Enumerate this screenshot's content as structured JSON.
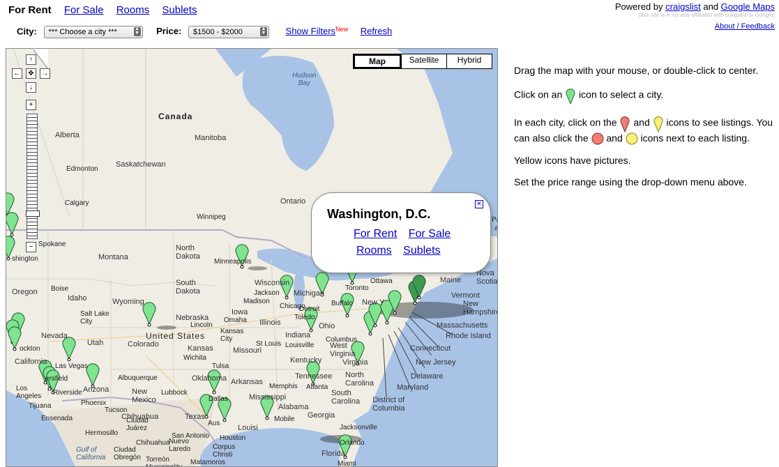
{
  "nav": {
    "current": "For Rent",
    "links": [
      "For Sale",
      "Rooms",
      "Sublets"
    ]
  },
  "powered": {
    "prefix": "Powered by",
    "craigslist": "craigslist",
    "and": "and",
    "gmaps": "Google Maps",
    "disclaimer": "(this site is in no way affiliated with craigslist or Google)",
    "about": "About / Feedback"
  },
  "filters": {
    "city_label": "City:",
    "city_value": "*** Choose a city ***",
    "price_label": "Price:",
    "price_value": "$1500 - $2000",
    "show_filters": "Show Filters",
    "new_badge": "New",
    "refresh": "Refresh"
  },
  "map": {
    "types": [
      "Map",
      "Satellite",
      "Hybrid"
    ],
    "active_type": "Map",
    "colors": {
      "water": "#a9c3e6",
      "land": "#f0ede5",
      "canada": "#ece9df",
      "marker": "#7fe38f",
      "marker_dark": "#3e9a52"
    },
    "labels": {
      "hudson": "Hudson\nBay",
      "canada": "Canada",
      "alberta": "Alberta",
      "manitoba": "Manitoba",
      "saskatchewan": "Saskatchewan",
      "edmonton": "Edmonton",
      "calgary": "Calgary",
      "ontario": "Ontario",
      "winnipeg": "Winnipeg",
      "spokane": "Spokane",
      "shington": "shington",
      "oregon": "Oregon",
      "boise": "Boise",
      "idaho": "Idaho",
      "montana": "Montana",
      "north_dakota": "North\nDakota",
      "south_dakota": "South\nDakota",
      "wyoming": "Wyoming",
      "minneapolis": "Minneapolis",
      "wisconsin": "Wisconsin",
      "jackson": "Jackson",
      "madison": "Madison",
      "michigan": "Michigan",
      "chicago": "Chicago",
      "detroit": "Detroit",
      "toronto": "Toronto",
      "ottawa": "Ottawa",
      "maine": "Maine",
      "nova_scotia": "Nova\nScotia",
      "vermont": "Vermont",
      "new_hampshire": "New\nHampshire",
      "massachusetts": "Massachusetts",
      "rhode_island": "Rhode Island",
      "connecticut": "Connecticut",
      "new_jersey": "New Jersey",
      "delaware": "Delaware",
      "maryland": "Maryland",
      "dc": "District of\nColumbia",
      "buffalo": "Buffalo",
      "toledo": "Toledo",
      "new_york": "New Y",
      "nevada": "Nevada",
      "utah": "Utah",
      "salt_lake": "Salt Lake\nCity",
      "colorado": "Colorado",
      "united_states": "United States",
      "nebraska": "Nebraska",
      "lincoln": "Lincoln",
      "omaha": "Omaha",
      "iowa": "Iowa",
      "illinois": "Illinois",
      "indiana": "Indiana",
      "ohio": "Ohio",
      "columbus": "Columbus",
      "louisville": "Louisville",
      "west_virginia": "West\nVirginia",
      "virginia": "Virginia",
      "kansas": "Kansas",
      "kansas_city": "Kansas\nCity",
      "wichita": "Wichita",
      "st_louis": "St Louis",
      "missouri": "Missouri",
      "kentucky": "Kentucky",
      "tennessee": "Tennessee",
      "north_carolina": "North\nCarolina",
      "south_carolina": "South\nCarolina",
      "atlanta": "Atlanta",
      "georgia": "Georgia",
      "alabama": "Alabama",
      "mississippi": "Mississippi",
      "memphis": "Memphis",
      "arkansas": "Arkansas",
      "oklahoma": "Oklahoma",
      "tulsa": "Tulsa",
      "dallas": "Dallas",
      "texas": "Texas",
      "austin": "Aus",
      "houston": "Houston",
      "san_antonio": "San Antonio",
      "louisiana": "Louisi",
      "mobile": "Mobile",
      "jacksonville": "Jacksonville",
      "orlando": "Orlando",
      "florida": "Florida",
      "miami": "Miami",
      "california": "California",
      "las_vegas": "Las Vegas",
      "bakersfield": "ersfield",
      "los_angeles": "Los\nAngeles",
      "riverside": "Riverside",
      "tijuana": "Tijuana",
      "ensenada": "Ensenada",
      "arizona": "Arizona",
      "phoenix": "Phoenix",
      "tucson": "Tucson",
      "albuquerque": "Albuquerque",
      "new_mexico": "New\nMexico",
      "lubbock": "Lubbock",
      "chihuahua": "Chihuahua",
      "ciudad_juarez": "Ciudad\nJuárez",
      "hermosillo": "Hermosillo",
      "gulf": "Gulf of\nCalifornia",
      "ciudad_obregon": "Ciudad\nObregón",
      "chihuahua2": "Chihuahua",
      "nuevo_laredo": "Nuevo\nLaredo",
      "corpus": "Corpus\nChristi",
      "torreon": "Torreón\nMunicipality",
      "matamoros": "Matamoros",
      "stockton": "ockton",
      "pal": "Pal",
      "a": "a"
    }
  },
  "popup": {
    "title": "Washington, D.C.",
    "links": [
      "For Rent",
      "For Sale",
      "Rooms",
      "Sublets"
    ]
  },
  "help": {
    "p1": "Drag the map with your mouse, or double-click to center.",
    "p2a": "Click on an",
    "p2b": "icon to select a city.",
    "p3a": "In each city, click on the",
    "p3b": "and",
    "p3c": "icons to see listings.",
    "p3d": "You can also click the",
    "p3e": "and",
    "p3f": "icons next to each listing.",
    "p4": "Yellow icons have pictures.",
    "p5": "Set the price range using the drop-down menu above."
  }
}
